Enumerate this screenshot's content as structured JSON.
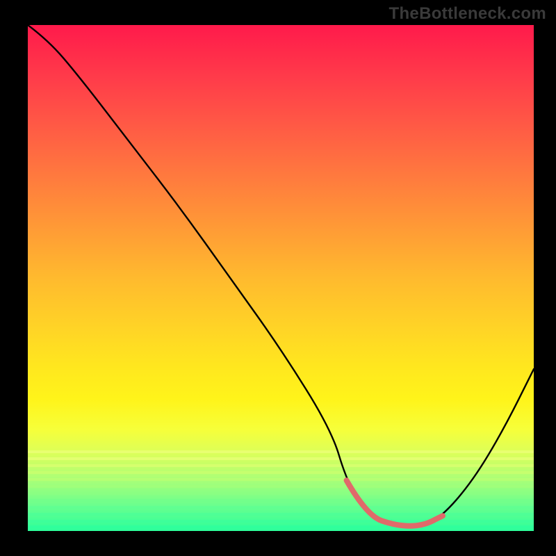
{
  "watermark": "TheBottleneck.com",
  "chart_data": {
    "type": "line",
    "title": "",
    "xlabel": "",
    "ylabel": "",
    "xlim": [
      0,
      100
    ],
    "ylim": [
      0,
      100
    ],
    "grid": false,
    "legend": false,
    "background": {
      "type": "vertical-gradient",
      "stops": [
        {
          "pos": 0,
          "color": "#ff1a4b"
        },
        {
          "pos": 50,
          "color": "#ffba2e"
        },
        {
          "pos": 74,
          "color": "#fff41a"
        },
        {
          "pos": 100,
          "color": "#2cff9a"
        }
      ]
    },
    "series": [
      {
        "name": "bottleneck-curve",
        "color": "#000000",
        "x": [
          0,
          4,
          10,
          20,
          30,
          40,
          50,
          60,
          63,
          67,
          73,
          78,
          82,
          88,
          94,
          100
        ],
        "values": [
          100,
          97,
          90,
          77,
          64,
          50,
          36,
          20,
          10,
          3,
          1,
          1,
          3,
          10,
          20,
          32
        ]
      }
    ],
    "annotations": [
      {
        "name": "valley-highlight",
        "type": "segment",
        "color": "#e06a6a",
        "xstart": 63,
        "xend": 82,
        "y": 2
      }
    ]
  },
  "colors": {
    "frame": "#000000",
    "curve": "#000000",
    "valley": "#e06a6a",
    "watermark": "#3a3a3a"
  }
}
